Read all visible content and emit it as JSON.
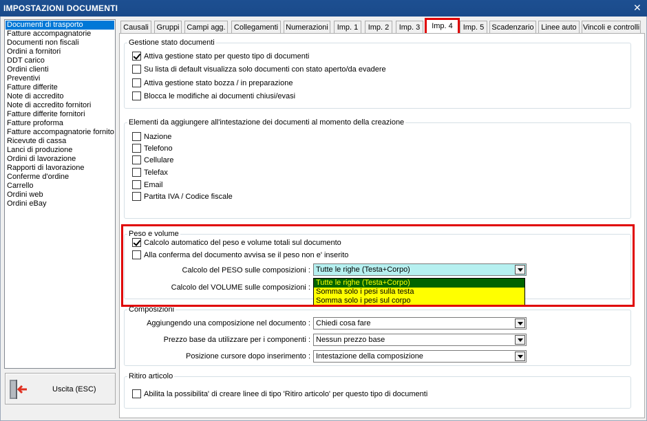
{
  "window": {
    "title": "IMPOSTAZIONI DOCUMENTI"
  },
  "doc_types": [
    "Documenti di trasporto",
    "Fatture accompagnatorie",
    "Documenti non fiscali",
    "Ordini a fornitori",
    "DDT carico",
    "Ordini clienti",
    "Preventivi",
    "Fatture differite",
    "Note di accredito",
    "Note di accredito fornitori",
    "Fatture differite fornitori",
    "Fatture proforma",
    "Fatture accompagnatorie fornito",
    "Ricevute di cassa",
    "Lanci di produzione",
    "Ordini di lavorazione",
    "Rapporti di lavorazione",
    "Conferme d'ordine",
    "Carrello",
    "Ordini web",
    "Ordini eBay"
  ],
  "selected_doc_type": "Documenti di trasporto",
  "exit_button": "Uscita (ESC)",
  "tabs": [
    "Causali",
    "Gruppi",
    "Campi agg.",
    "Collegamenti",
    "Numerazioni",
    "Imp. 1",
    "Imp. 2",
    "Imp. 3",
    "Imp. 4",
    "Imp. 5",
    "Scadenzario",
    "Linee auto",
    "Vincoli e controlli"
  ],
  "active_tab": "Imp. 4",
  "gestione": {
    "legend": "Gestione stato documenti",
    "items": [
      {
        "label": "Attiva gestione stato per questo tipo di documenti",
        "checked": true
      },
      {
        "label": "Su lista di default visualizza solo documenti con stato aperto/da evadere",
        "checked": false
      },
      {
        "label": "Attiva gestione stato bozza / in preparazione",
        "checked": false
      },
      {
        "label": "Blocca le modifiche ai documenti chiusi/evasi",
        "checked": false
      }
    ]
  },
  "intestazione": {
    "legend": "Elementi da aggiungere all'intestazione dei documenti al momento della creazione",
    "items": [
      {
        "label": "Nazione",
        "checked": false
      },
      {
        "label": "Telefono",
        "checked": false
      },
      {
        "label": "Cellulare",
        "checked": false
      },
      {
        "label": "Telefax",
        "checked": false
      },
      {
        "label": "Email",
        "checked": false
      },
      {
        "label": "Partita IVA / Codice fiscale",
        "checked": false
      }
    ]
  },
  "peso": {
    "legend": "Peso e volume",
    "items": [
      {
        "label": "Calcolo automatico del peso e volume totali sul documento",
        "checked": true
      },
      {
        "label": "Alla conferma del documento avvisa se il peso non e' inserito",
        "checked": false
      }
    ],
    "peso_label": "Calcolo del PESO sulle composizioni :",
    "peso_value": "Tutte le righe (Testa+Corpo)",
    "volume_label": "Calcolo del VOLUME sulle composizioni :",
    "options": [
      "Tutte le righe (Testa+Corpo)",
      "Somma solo i pesi sulla testa",
      "Somma solo i pesi sul corpo"
    ]
  },
  "composizioni": {
    "legend": "Composizioni",
    "rows": [
      {
        "label": "Aggiungendo una composizione nel documento :",
        "value": "Chiedi cosa fare"
      },
      {
        "label": "Prezzo base da utilizzare per i componenti :",
        "value": "Nessun prezzo base"
      },
      {
        "label": "Posizione cursore dopo inserimento :",
        "value": "Intestazione della composizione"
      }
    ]
  },
  "ritiro": {
    "legend": "Ritiro articolo",
    "item": {
      "label": "Abilita la possibilita' di creare linee di tipo 'Ritiro articolo' per questo tipo di documenti",
      "checked": false
    }
  },
  "colors": {
    "title_bar": "#1d4f91",
    "selection": "#0078d7",
    "highlight": "#e00000",
    "dropdown_bg": "#ffff00",
    "dropdown_sel": "#006400",
    "peso_combo": "#b6f0f0"
  }
}
